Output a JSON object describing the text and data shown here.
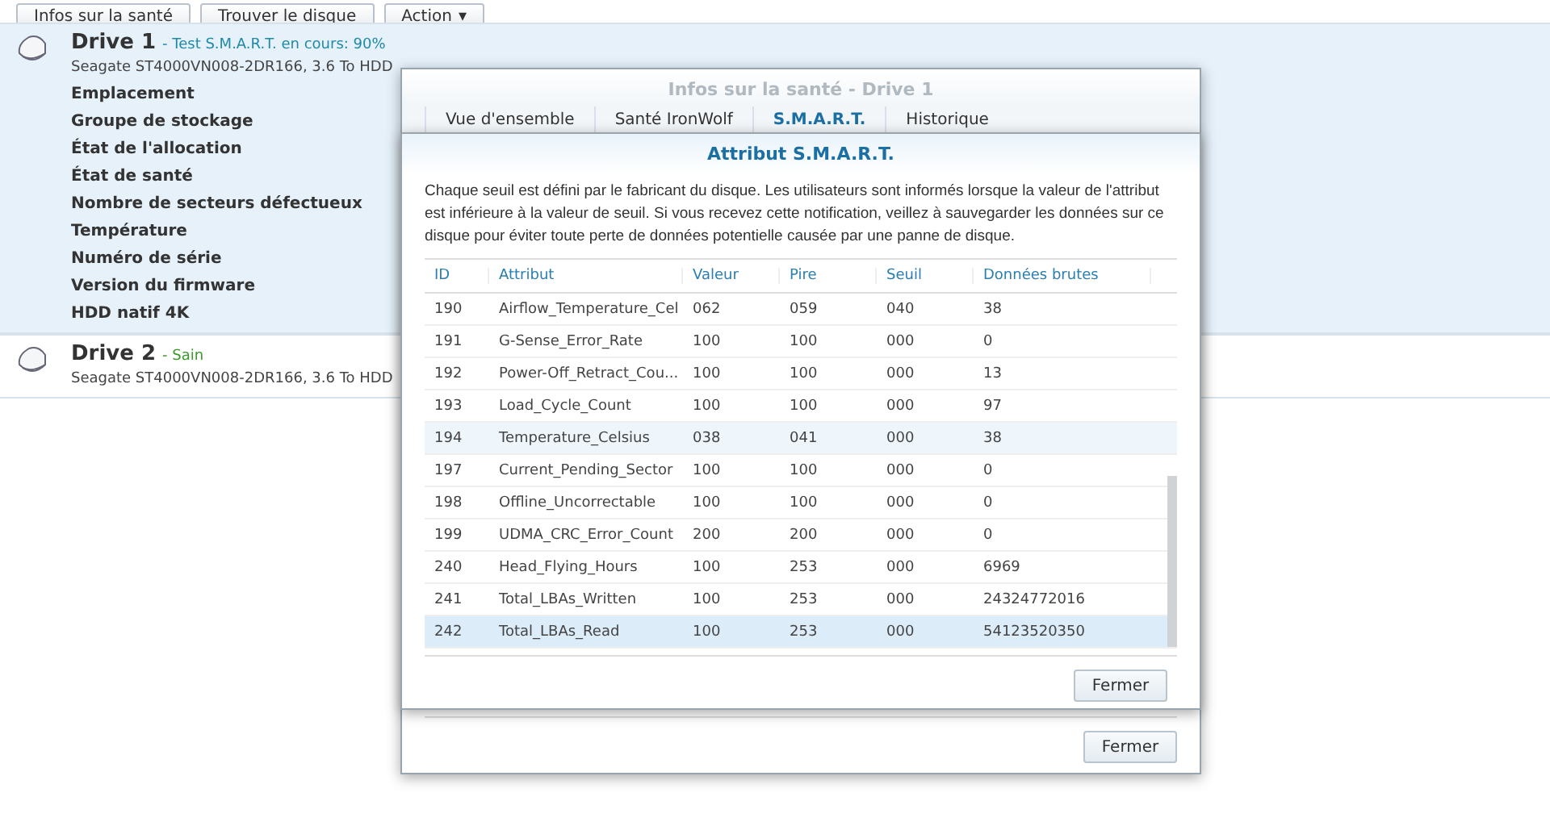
{
  "toolbar": {
    "buttons": [
      {
        "label": "Infos sur la santé",
        "kind": "plain"
      },
      {
        "label": "Trouver le disque",
        "kind": "plain"
      },
      {
        "label": "Action",
        "caret": "▾",
        "kind": "menu"
      }
    ]
  },
  "drives": [
    {
      "name": "Drive 1",
      "status": "- Test S.M.A.R.T. en cours: 90%",
      "color": "#1f8aa8",
      "model": "Seagate ST4000VN008-2DR166, 3.6 To HDD",
      "expanded": true,
      "fields": [
        "Emplacement",
        "Groupe de stockage",
        "État de l'allocation",
        "État de santé",
        "Nombre de secteurs défectueux",
        "Température",
        "Numéro de série",
        "Version du firmware",
        "HDD natif 4K"
      ]
    },
    {
      "name": "Drive 2",
      "status": "- Sain",
      "color": "#3b9a2a",
      "model": "Seagate ST4000VN008-2DR166, 3.6 To HDD",
      "expanded": false
    }
  ],
  "health_dialog": {
    "title": "Infos sur la santé - Drive 1",
    "tabs": [
      {
        "label": "Vue d'ensemble",
        "selected": false
      },
      {
        "label": "Santé IronWolf",
        "selected": false
      },
      {
        "label": "S.M.A.R.T.",
        "selected": true
      },
      {
        "label": "Historique",
        "selected": false
      }
    ],
    "close_button": "Fermer"
  },
  "smart_dialog": {
    "title": "Attribut S.M.A.R.T.",
    "description": "Chaque seuil est défini par le fabricant du disque. Les utilisateurs sont informés lorsque la valeur de l'attribut est inférieure à la valeur de seuil. Si vous recevez cette notification, veillez à sauvegarder les données sur ce disque pour éviter toute perte de données potentielle causée par une panne de disque.",
    "columns": [
      "ID",
      "Attribut",
      "Valeur",
      "Pire",
      "Seuil",
      "Données brutes"
    ],
    "rows": [
      {
        "cells": [
          "190",
          "Airflow_Temperature_Cel",
          "062",
          "059",
          "040",
          "38"
        ],
        "highlighted": false,
        "selected": false
      },
      {
        "cells": [
          "191",
          "G-Sense_Error_Rate",
          "100",
          "100",
          "000",
          "0"
        ],
        "highlighted": false,
        "selected": false
      },
      {
        "cells": [
          "192",
          "Power-Off_Retract_Cou...",
          "100",
          "100",
          "000",
          "13"
        ],
        "highlighted": false,
        "selected": false
      },
      {
        "cells": [
          "193",
          "Load_Cycle_Count",
          "100",
          "100",
          "000",
          "97"
        ],
        "highlighted": false,
        "selected": false
      },
      {
        "cells": [
          "194",
          "Temperature_Celsius",
          "038",
          "041",
          "000",
          "38"
        ],
        "highlighted": true,
        "selected": false
      },
      {
        "cells": [
          "197",
          "Current_Pending_Sector",
          "100",
          "100",
          "000",
          "0"
        ],
        "highlighted": false,
        "selected": false
      },
      {
        "cells": [
          "198",
          "Offline_Uncorrectable",
          "100",
          "100",
          "000",
          "0"
        ],
        "highlighted": false,
        "selected": false
      },
      {
        "cells": [
          "199",
          "UDMA_CRC_Error_Count",
          "200",
          "200",
          "000",
          "0"
        ],
        "highlighted": false,
        "selected": false
      },
      {
        "cells": [
          "240",
          "Head_Flying_Hours",
          "100",
          "253",
          "000",
          "6969"
        ],
        "highlighted": false,
        "selected": false
      },
      {
        "cells": [
          "241",
          "Total_LBAs_Written",
          "100",
          "253",
          "000",
          "24324772016"
        ],
        "highlighted": false,
        "selected": false
      },
      {
        "cells": [
          "242",
          "Total_LBAs_Read",
          "100",
          "253",
          "000",
          "54123520350"
        ],
        "highlighted": false,
        "selected": true
      }
    ],
    "close_button": "Fermer"
  }
}
